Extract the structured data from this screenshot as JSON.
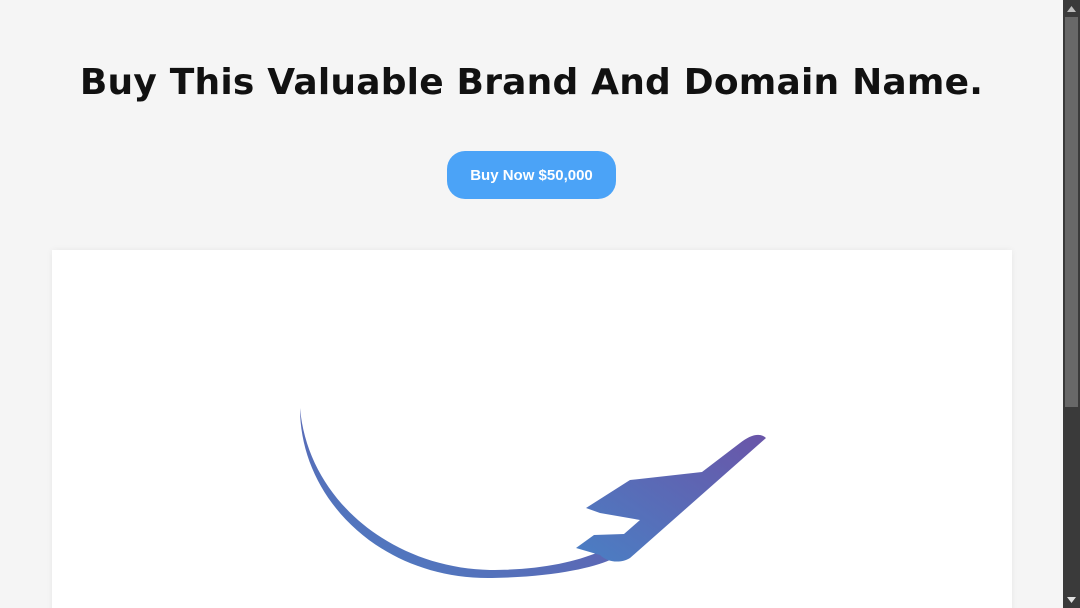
{
  "hero": {
    "headline": "Buy This Valuable Brand And Domain Name.",
    "buy_button_label": "Buy Now $50,000"
  },
  "logo": {
    "icon": "airplane-orbit-logo",
    "gradient_start": "#4a7fc4",
    "gradient_end": "#6a55a8"
  },
  "colors": {
    "page_background": "#f5f5f5",
    "button_background": "#4ba3f7",
    "card_background": "#ffffff",
    "scrollbar_track": "#3a3a3a",
    "scrollbar_thumb": "#686868"
  }
}
